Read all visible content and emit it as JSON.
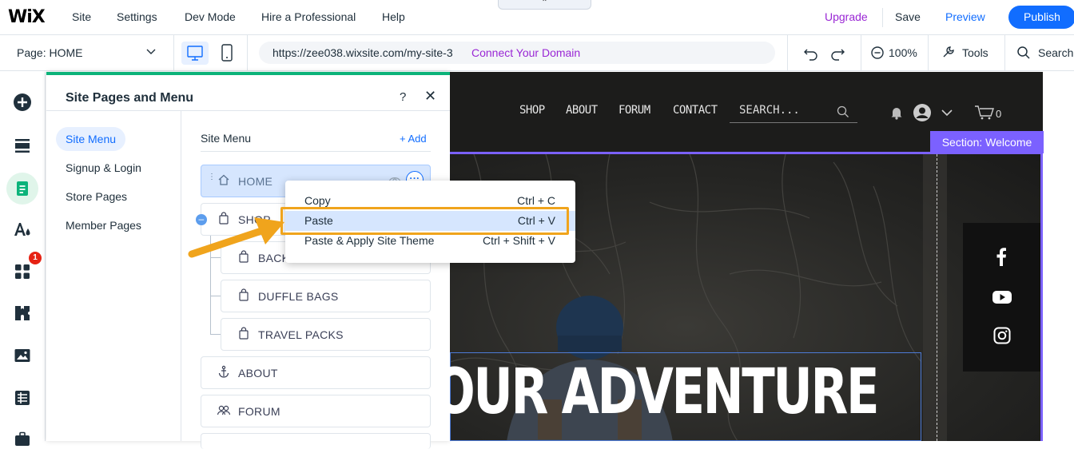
{
  "topbar": {
    "logo": "WiX",
    "menu": [
      "Site",
      "Settings",
      "Dev Mode",
      "Hire a Professional",
      "Help"
    ],
    "upgrade": "Upgrade",
    "save": "Save",
    "preview": "Preview",
    "publish": "Publish"
  },
  "secondbar": {
    "page": "Page: HOME",
    "url": "https://zee038.wixsite.com/my-site-3",
    "connect_domain": "Connect Your Domain",
    "zoom": "100%",
    "tools": "Tools",
    "search": "Search"
  },
  "rail": {
    "badge": "1"
  },
  "panel": {
    "title": "Site Pages and Menu",
    "help": "?",
    "close": "✕",
    "categories": [
      "Site Menu",
      "Signup & Login",
      "Store Pages",
      "Member Pages"
    ],
    "menu_heading": "Site Menu",
    "add": "Add",
    "items": [
      "HOME",
      "SHOP",
      "BACKPACKS",
      "DUFFLE BAGS",
      "TRAVEL PACKS",
      "ABOUT",
      "FORUM"
    ]
  },
  "context_menu": {
    "items": [
      {
        "label": "Copy",
        "shortcut": "Ctrl + C"
      },
      {
        "label": "Paste",
        "shortcut": "Ctrl + V"
      },
      {
        "label": "Paste & Apply Site Theme",
        "shortcut": "Ctrl + Shift + V"
      }
    ]
  },
  "site": {
    "nav": [
      "SHOP",
      "ABOUT",
      "FORUM",
      "CONTACT"
    ],
    "search_placeholder": "SEARCH...",
    "cart_count": "0",
    "section_label": "Section: Welcome",
    "hero_title": "OUR ADVENTURE"
  },
  "colors": {
    "brand_blue": "#116dff",
    "upgrade_purple": "#9a27d5",
    "panel_accent": "#0cb37a",
    "section_purple": "#7b61ff",
    "highlight_orange": "#f0a41c"
  }
}
